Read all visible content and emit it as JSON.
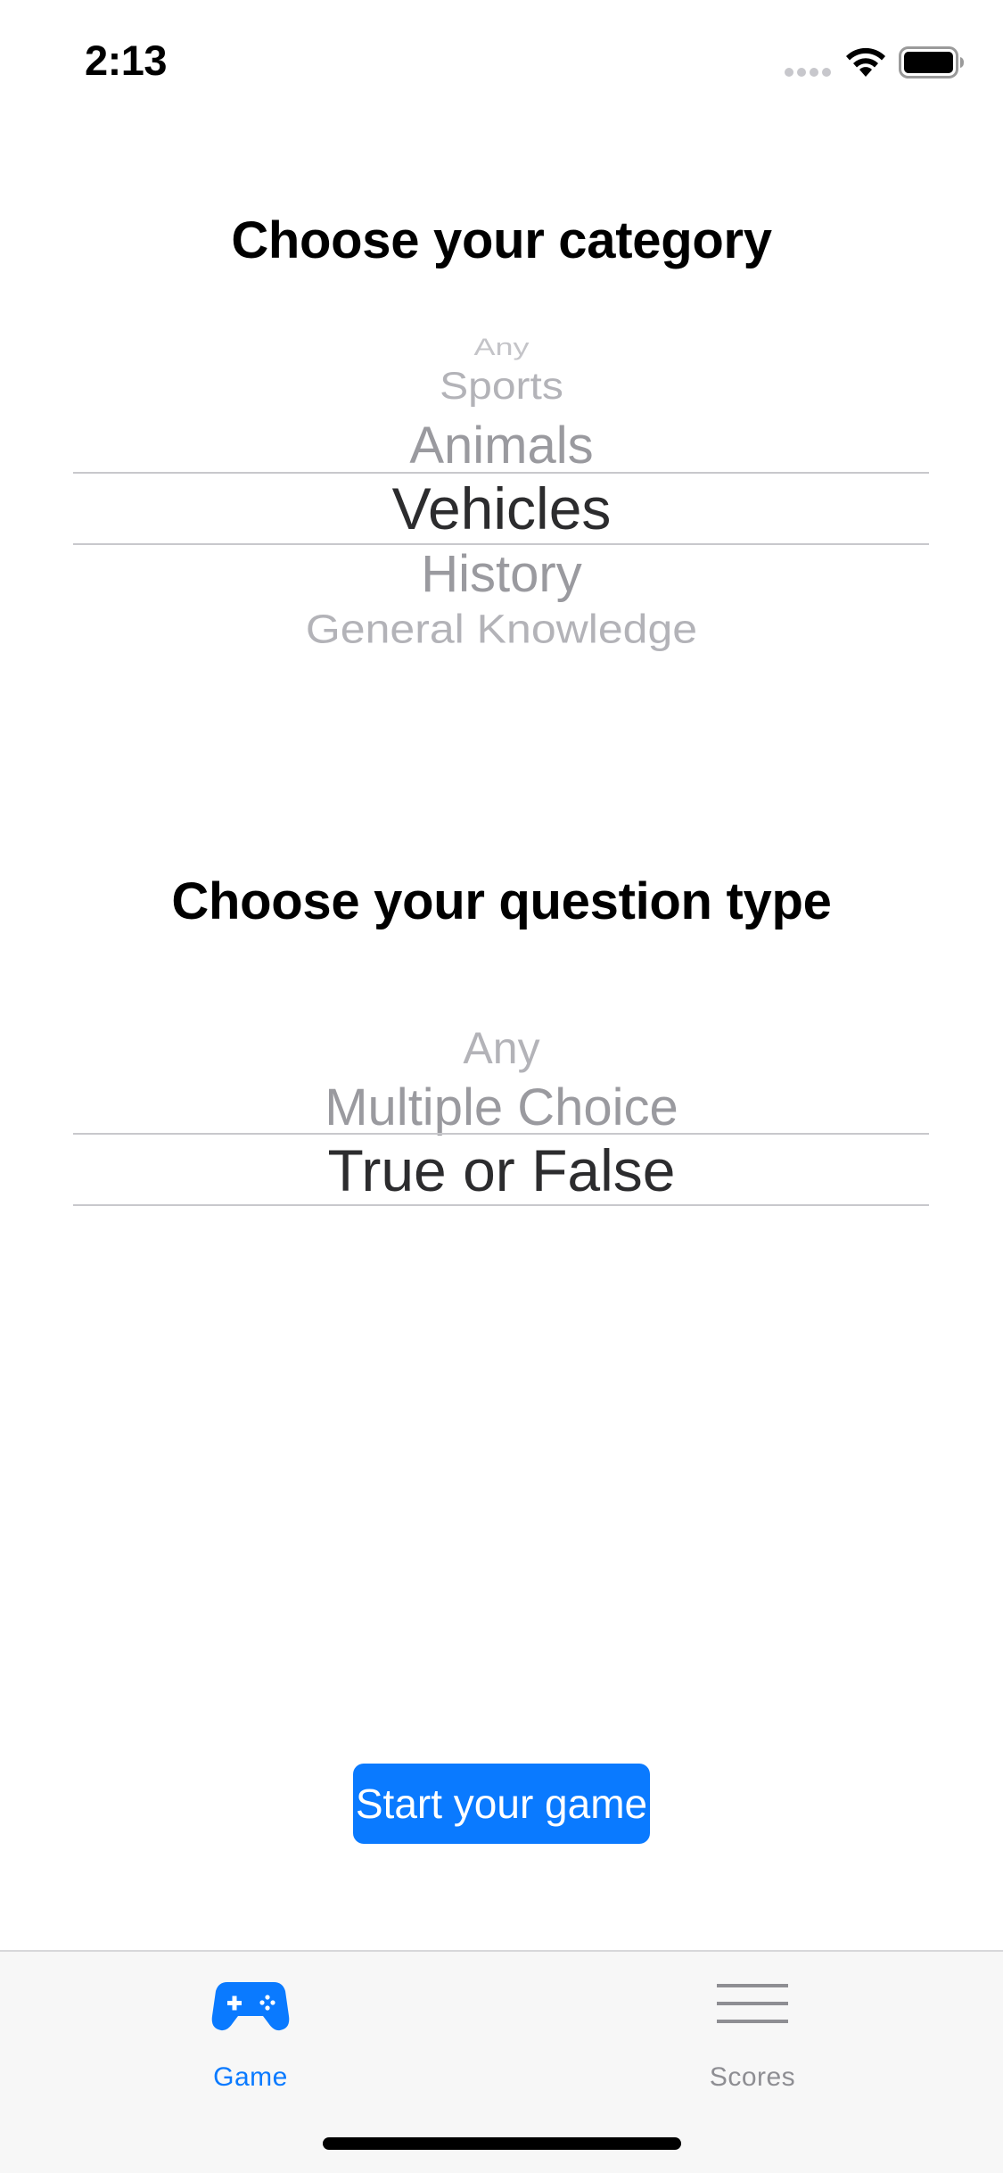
{
  "status_bar": {
    "time": "2:13"
  },
  "category_section": {
    "title": "Choose your category",
    "options": [
      "Any",
      "Sports",
      "Animals",
      "Vehicles",
      "History",
      "General Knowledge"
    ],
    "selected": "Vehicles"
  },
  "question_type_section": {
    "title": "Choose your question type",
    "options": [
      "Any",
      "Multiple Choice",
      "True or False"
    ],
    "selected": "True or False"
  },
  "start_button": {
    "label": "Start your game"
  },
  "tab_bar": {
    "tabs": [
      {
        "label": "Game",
        "icon": "gamecontroller-icon",
        "active": true
      },
      {
        "label": "Scores",
        "icon": "list-icon",
        "active": false
      }
    ]
  },
  "colors": {
    "accent": "#0a7aff",
    "inactive_tab": "#8e8e93",
    "picker_selected": "#2c2c2e",
    "picker_unselected": "#9a9a9f"
  }
}
